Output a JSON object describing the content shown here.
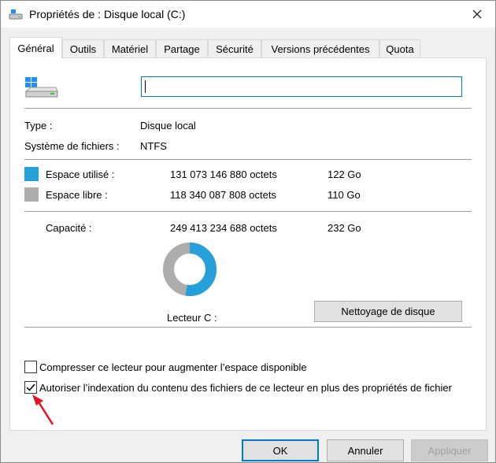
{
  "window": {
    "title": "Propriétés de : Disque local (C:)",
    "close_icon": "close-icon"
  },
  "tabs": [
    {
      "label": "Général",
      "active": true
    },
    {
      "label": "Outils"
    },
    {
      "label": "Matériel"
    },
    {
      "label": "Partage"
    },
    {
      "label": "Sécurité"
    },
    {
      "label": "Versions précédentes"
    },
    {
      "label": "Quota"
    }
  ],
  "general": {
    "drive_name_value": "",
    "type_label": "Type :",
    "type_value": "Disque local",
    "fs_label": "Système de fichiers :",
    "fs_value": "NTFS",
    "used_label": "Espace utilisé :",
    "used_bytes": "131 073 146 880 octets",
    "used_size": "122 Go",
    "used_color": "#26a0da",
    "free_label": "Espace libre :",
    "free_bytes": "118 340 087 808 octets",
    "free_size": "110 Go",
    "free_color": "#adadad",
    "capacity_label": "Capacité :",
    "capacity_bytes": "249 413 234 688 octets",
    "capacity_size": "232 Go",
    "drive_label": "Lecteur C :",
    "cleanup_button": "Nettoyage de disque",
    "used_fraction": 0.5255
  },
  "options": {
    "compress_label": "Compresser ce lecteur pour augmenter l’espace disponible",
    "compress_checked": false,
    "index_label": "Autoriser l’indexation du contenu des fichiers de ce lecteur en plus des propriétés de fichier",
    "index_checked": true
  },
  "buttons": {
    "ok": "OK",
    "cancel": "Annuler",
    "apply": "Appliquer"
  },
  "annotation": {
    "arrow_color": "#e81123"
  }
}
